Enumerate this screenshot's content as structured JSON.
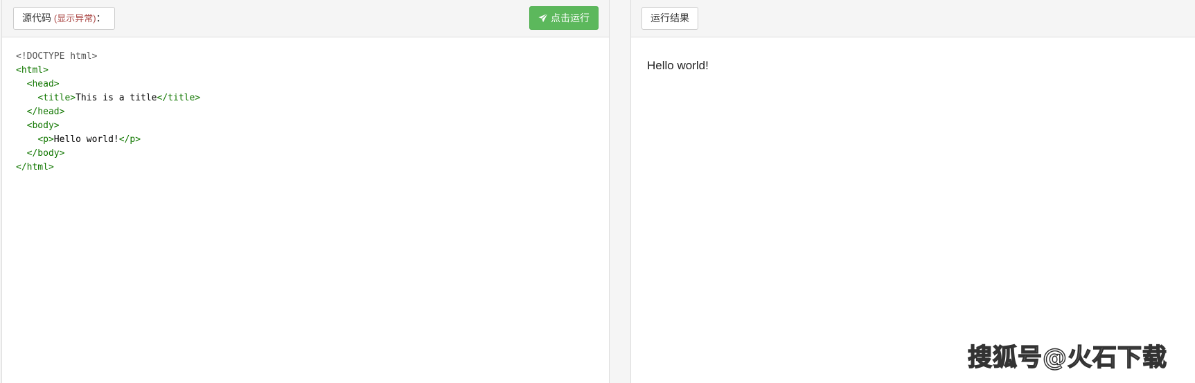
{
  "source_panel": {
    "label": "源代码",
    "note": "(显示异常)",
    "suffix": "：",
    "run_button_label": "点击运行",
    "run_icon": "paper-plane-icon",
    "code_lines": [
      [
        {
          "t": "doc",
          "v": "<!DOCTYPE html>"
        }
      ],
      [
        {
          "t": "tag",
          "v": "<html>"
        }
      ],
      [
        {
          "t": "sp",
          "v": "  "
        },
        {
          "t": "tag",
          "v": "<head>"
        }
      ],
      [
        {
          "t": "sp",
          "v": "    "
        },
        {
          "t": "tag",
          "v": "<title>"
        },
        {
          "t": "text",
          "v": "This is a title"
        },
        {
          "t": "tag",
          "v": "</title>"
        }
      ],
      [
        {
          "t": "sp",
          "v": "  "
        },
        {
          "t": "tag",
          "v": "</head>"
        }
      ],
      [
        {
          "t": "sp",
          "v": "  "
        },
        {
          "t": "tag",
          "v": "<body>"
        }
      ],
      [
        {
          "t": "sp",
          "v": "    "
        },
        {
          "t": "tag",
          "v": "<p>"
        },
        {
          "t": "text",
          "v": "Hello world!"
        },
        {
          "t": "tag",
          "v": "</p>"
        }
      ],
      [
        {
          "t": "sp",
          "v": "  "
        },
        {
          "t": "tag",
          "v": "</body>"
        }
      ],
      [
        {
          "t": "tag",
          "v": "</html>"
        }
      ]
    ]
  },
  "result_panel": {
    "label": "运行结果",
    "output": "Hello world!"
  },
  "watermark": "搜狐号@火石下载",
  "colors": {
    "run_button": "#5cb85c",
    "tag": "#117700",
    "note": "#a94442"
  }
}
